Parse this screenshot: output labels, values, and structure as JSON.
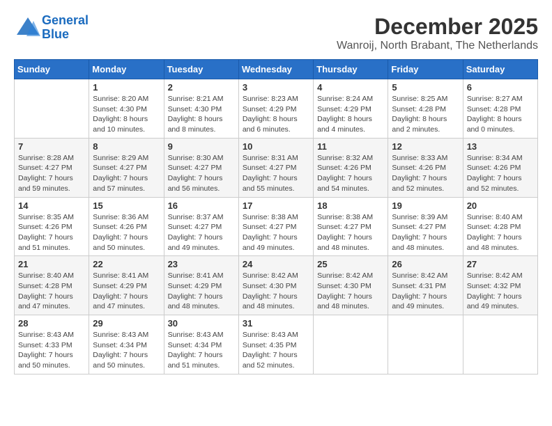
{
  "header": {
    "logo_line1": "General",
    "logo_line2": "Blue",
    "month": "December 2025",
    "location": "Wanroij, North Brabant, The Netherlands"
  },
  "days_of_week": [
    "Sunday",
    "Monday",
    "Tuesday",
    "Wednesday",
    "Thursday",
    "Friday",
    "Saturday"
  ],
  "weeks": [
    [
      {
        "day": "",
        "info": ""
      },
      {
        "day": "1",
        "info": "Sunrise: 8:20 AM\nSunset: 4:30 PM\nDaylight: 8 hours\nand 10 minutes."
      },
      {
        "day": "2",
        "info": "Sunrise: 8:21 AM\nSunset: 4:30 PM\nDaylight: 8 hours\nand 8 minutes."
      },
      {
        "day": "3",
        "info": "Sunrise: 8:23 AM\nSunset: 4:29 PM\nDaylight: 8 hours\nand 6 minutes."
      },
      {
        "day": "4",
        "info": "Sunrise: 8:24 AM\nSunset: 4:29 PM\nDaylight: 8 hours\nand 4 minutes."
      },
      {
        "day": "5",
        "info": "Sunrise: 8:25 AM\nSunset: 4:28 PM\nDaylight: 8 hours\nand 2 minutes."
      },
      {
        "day": "6",
        "info": "Sunrise: 8:27 AM\nSunset: 4:28 PM\nDaylight: 8 hours\nand 0 minutes."
      }
    ],
    [
      {
        "day": "7",
        "info": "Sunrise: 8:28 AM\nSunset: 4:27 PM\nDaylight: 7 hours\nand 59 minutes."
      },
      {
        "day": "8",
        "info": "Sunrise: 8:29 AM\nSunset: 4:27 PM\nDaylight: 7 hours\nand 57 minutes."
      },
      {
        "day": "9",
        "info": "Sunrise: 8:30 AM\nSunset: 4:27 PM\nDaylight: 7 hours\nand 56 minutes."
      },
      {
        "day": "10",
        "info": "Sunrise: 8:31 AM\nSunset: 4:27 PM\nDaylight: 7 hours\nand 55 minutes."
      },
      {
        "day": "11",
        "info": "Sunrise: 8:32 AM\nSunset: 4:26 PM\nDaylight: 7 hours\nand 54 minutes."
      },
      {
        "day": "12",
        "info": "Sunrise: 8:33 AM\nSunset: 4:26 PM\nDaylight: 7 hours\nand 52 minutes."
      },
      {
        "day": "13",
        "info": "Sunrise: 8:34 AM\nSunset: 4:26 PM\nDaylight: 7 hours\nand 52 minutes."
      }
    ],
    [
      {
        "day": "14",
        "info": "Sunrise: 8:35 AM\nSunset: 4:26 PM\nDaylight: 7 hours\nand 51 minutes."
      },
      {
        "day": "15",
        "info": "Sunrise: 8:36 AM\nSunset: 4:26 PM\nDaylight: 7 hours\nand 50 minutes."
      },
      {
        "day": "16",
        "info": "Sunrise: 8:37 AM\nSunset: 4:27 PM\nDaylight: 7 hours\nand 49 minutes."
      },
      {
        "day": "17",
        "info": "Sunrise: 8:38 AM\nSunset: 4:27 PM\nDaylight: 7 hours\nand 49 minutes."
      },
      {
        "day": "18",
        "info": "Sunrise: 8:38 AM\nSunset: 4:27 PM\nDaylight: 7 hours\nand 48 minutes."
      },
      {
        "day": "19",
        "info": "Sunrise: 8:39 AM\nSunset: 4:27 PM\nDaylight: 7 hours\nand 48 minutes."
      },
      {
        "day": "20",
        "info": "Sunrise: 8:40 AM\nSunset: 4:28 PM\nDaylight: 7 hours\nand 48 minutes."
      }
    ],
    [
      {
        "day": "21",
        "info": "Sunrise: 8:40 AM\nSunset: 4:28 PM\nDaylight: 7 hours\nand 47 minutes."
      },
      {
        "day": "22",
        "info": "Sunrise: 8:41 AM\nSunset: 4:29 PM\nDaylight: 7 hours\nand 47 minutes."
      },
      {
        "day": "23",
        "info": "Sunrise: 8:41 AM\nSunset: 4:29 PM\nDaylight: 7 hours\nand 48 minutes."
      },
      {
        "day": "24",
        "info": "Sunrise: 8:42 AM\nSunset: 4:30 PM\nDaylight: 7 hours\nand 48 minutes."
      },
      {
        "day": "25",
        "info": "Sunrise: 8:42 AM\nSunset: 4:30 PM\nDaylight: 7 hours\nand 48 minutes."
      },
      {
        "day": "26",
        "info": "Sunrise: 8:42 AM\nSunset: 4:31 PM\nDaylight: 7 hours\nand 49 minutes."
      },
      {
        "day": "27",
        "info": "Sunrise: 8:42 AM\nSunset: 4:32 PM\nDaylight: 7 hours\nand 49 minutes."
      }
    ],
    [
      {
        "day": "28",
        "info": "Sunrise: 8:43 AM\nSunset: 4:33 PM\nDaylight: 7 hours\nand 50 minutes."
      },
      {
        "day": "29",
        "info": "Sunrise: 8:43 AM\nSunset: 4:34 PM\nDaylight: 7 hours\nand 50 minutes."
      },
      {
        "day": "30",
        "info": "Sunrise: 8:43 AM\nSunset: 4:34 PM\nDaylight: 7 hours\nand 51 minutes."
      },
      {
        "day": "31",
        "info": "Sunrise: 8:43 AM\nSunset: 4:35 PM\nDaylight: 7 hours\nand 52 minutes."
      },
      {
        "day": "",
        "info": ""
      },
      {
        "day": "",
        "info": ""
      },
      {
        "day": "",
        "info": ""
      }
    ]
  ]
}
